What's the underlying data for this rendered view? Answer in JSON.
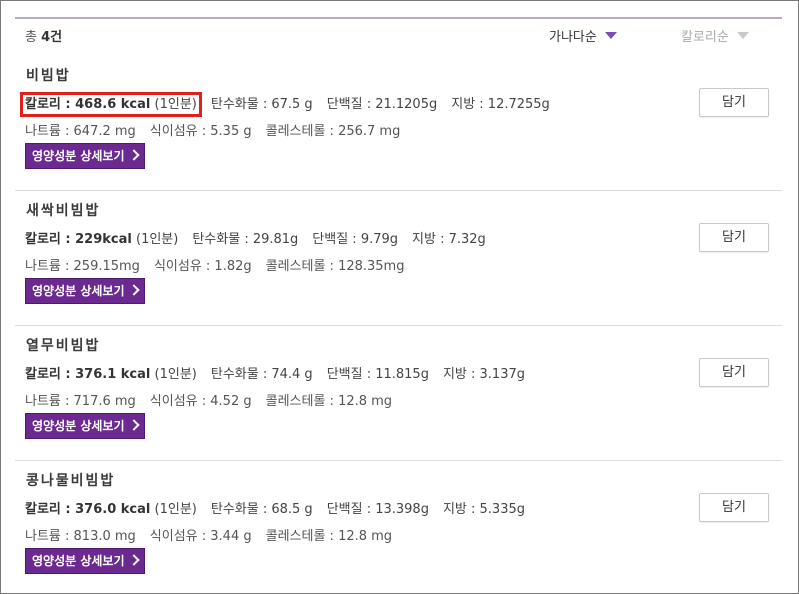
{
  "header": {
    "total_prefix": "총 ",
    "total_count": "4건",
    "sort_alpha": "가나다순",
    "sort_calorie": "칼로리순"
  },
  "items": [
    {
      "name": "비빔밥",
      "calorie_label": "칼로리 : ",
      "calorie_value": "468.6 kcal",
      "serving": "(1인분)",
      "carbs": "탄수화물 : 67.5 g",
      "protein": "단백질 : 21.1205g",
      "fat": "지방 : 12.7255g",
      "sodium": "나트륨 : 647.2 mg",
      "fiber": "식이섬유 : 5.35 g",
      "cholesterol": "콜레스테롤 : 256.7 mg",
      "detail_label": "영양성분 상세보기",
      "add_label": "담기"
    },
    {
      "name": "새싹비빔밥",
      "calorie_label": "칼로리 : ",
      "calorie_value": "229kcal",
      "serving": "(1인분)",
      "carbs": "탄수화물 : 29.81g",
      "protein": "단백질 : 9.79g",
      "fat": "지방 : 7.32g",
      "sodium": "나트륨 : 259.15mg",
      "fiber": "식이섬유 : 1.82g",
      "cholesterol": "콜레스테롤 : 128.35mg",
      "detail_label": "영양성분 상세보기",
      "add_label": "담기"
    },
    {
      "name": "열무비빔밥",
      "calorie_label": "칼로리 : ",
      "calorie_value": "376.1 kcal",
      "serving": "(1인분)",
      "carbs": "탄수화물 : 74.4 g",
      "protein": "단백질 : 11.815g",
      "fat": "지방 : 3.137g",
      "sodium": "나트륨 : 717.6 mg",
      "fiber": "식이섬유 : 4.52 g",
      "cholesterol": "콜레스테롤 : 12.8 mg",
      "detail_label": "영양성분 상세보기",
      "add_label": "담기"
    },
    {
      "name": "콩나물비빔밥",
      "calorie_label": "칼로리 : ",
      "calorie_value": "376.0 kcal",
      "serving": "(1인분)",
      "carbs": "탄수화물 : 68.5 g",
      "protein": "단백질 : 13.398g",
      "fat": "지방 : 5.335g",
      "sodium": "나트륨 : 813.0 mg",
      "fiber": "식이섬유 : 3.44 g",
      "cholesterol": "콜레스테롤 : 12.8 mg",
      "detail_label": "영양성분 상세보기",
      "add_label": "담기"
    }
  ],
  "colors": {
    "accent_purple": "#6c2a91",
    "highlight_red": "#e0201a"
  },
  "icons": [
    "chevron-right-icon",
    "sort-triangle-icon"
  ]
}
